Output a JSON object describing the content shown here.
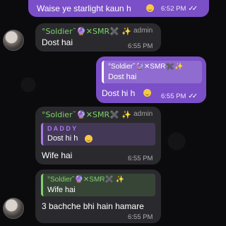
{
  "messages": {
    "m1": {
      "text": "Waise ye starlight kaun h",
      "time": "6:52 PM",
      "ticks": "✓✓"
    },
    "m2": {
      "sender": "°Soldier˘🔮✕SMR✖️ ✨",
      "role": "admin",
      "text": "Dost hai",
      "time": "6:55 PM"
    },
    "m3": {
      "quote_sender": "°Soldier˘🔮✕SMR✖️✨",
      "quote_text": "Dost hai",
      "text": "Dost hi h",
      "time": "6:55 PM",
      "ticks": "✓✓"
    },
    "m4": {
      "sender": "°Soldier˘🔮✕SMR✖️ ✨",
      "role": "admin",
      "quote_sender": "D A D D Y",
      "quote_text": "Dost hi h",
      "text": "Wife hai",
      "time": "6:55 PM"
    },
    "m5": {
      "quote_sender": "°Soldier˘🔮✕SMR✖️ ✨",
      "quote_text": "Wife hai",
      "text": "3 bachche bhi hain hamare",
      "time": "6:55 PM"
    }
  },
  "colors": {
    "outgoing_bubble": "#7b4fc7",
    "incoming_bubble": "#2a2a2e",
    "sender_name": "#7ed26b",
    "daddy_name": "#a97ae8",
    "background": "#0b0b0d"
  }
}
